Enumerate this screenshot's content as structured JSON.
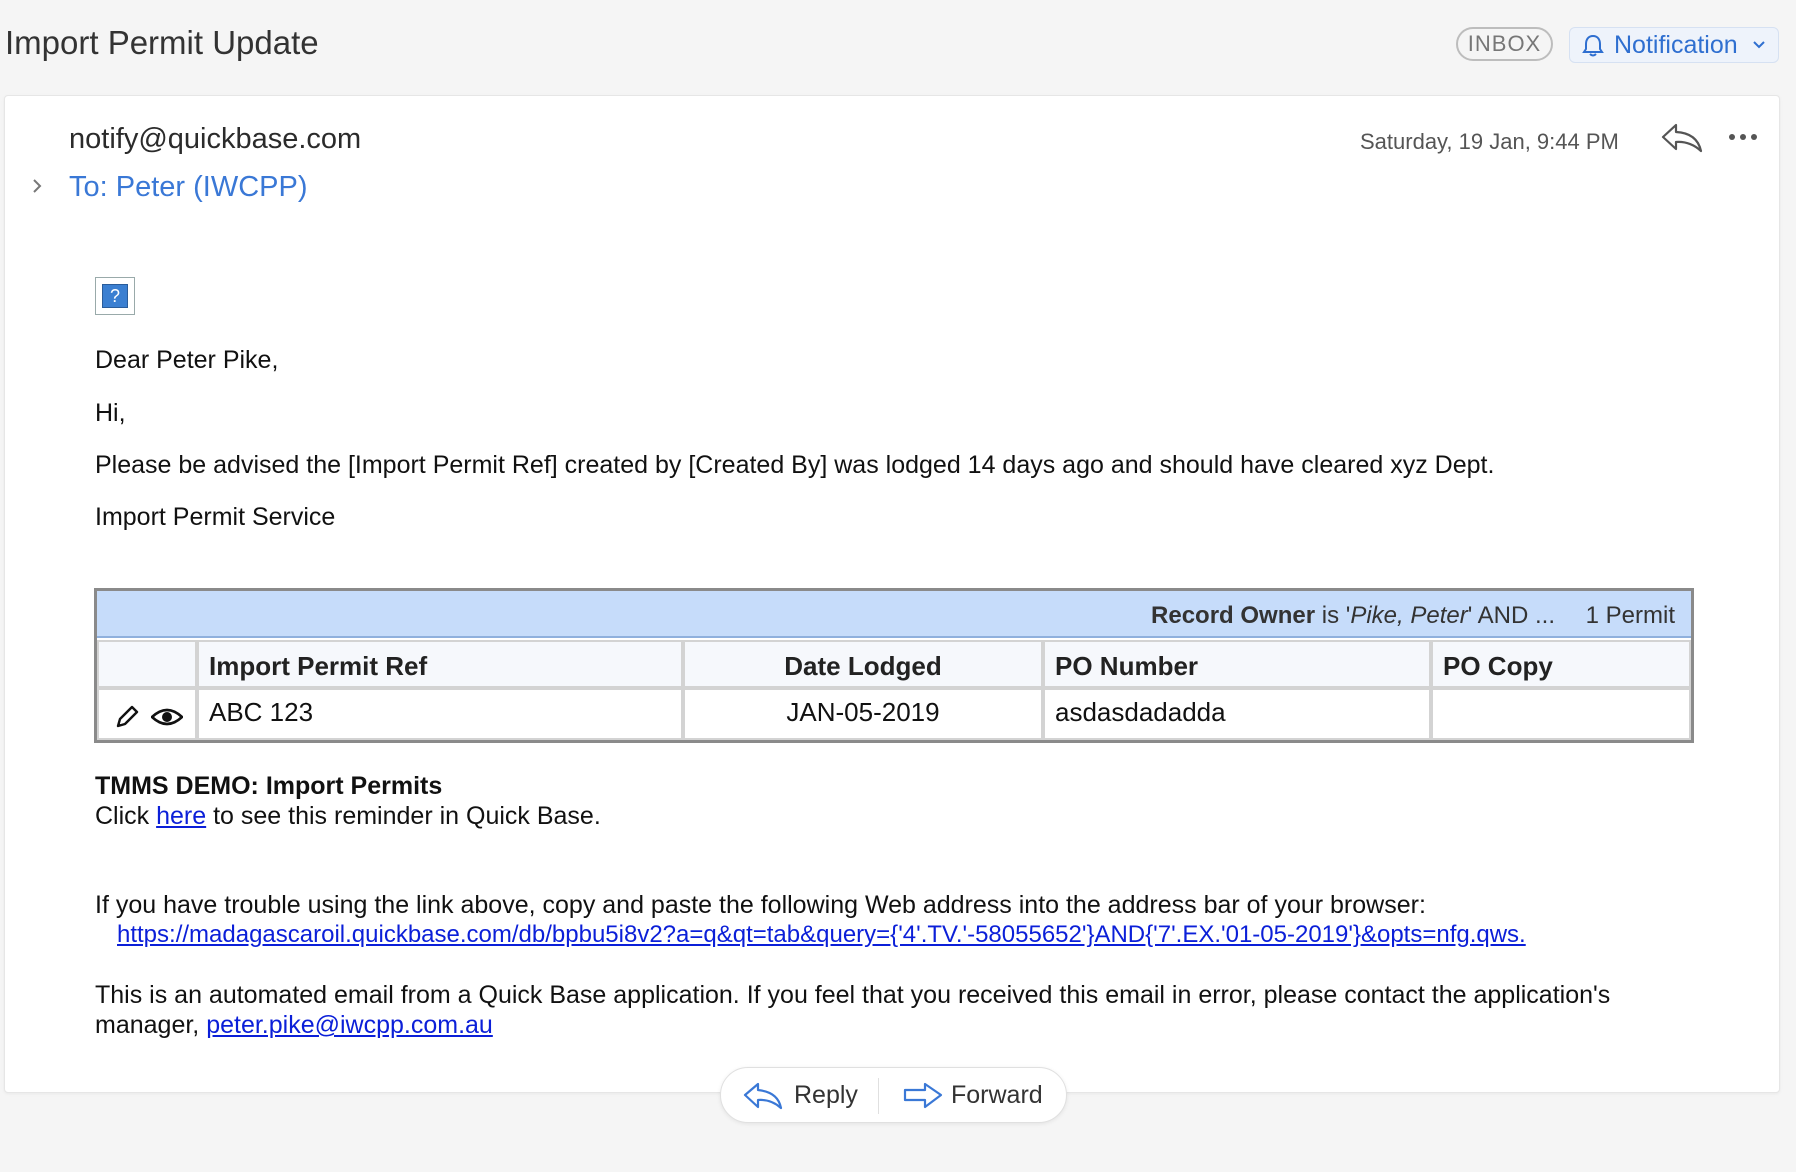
{
  "header": {
    "subject": "Import Permit Update",
    "folder_badge": "INBOX",
    "notification_label": "Notification"
  },
  "message": {
    "from": "notify@quickbase.com",
    "to": "To: Peter (IWCPP)",
    "timestamp": "Saturday, 19 Jan, 9:44 PM"
  },
  "body": {
    "broken_image_glyph": "?",
    "greeting": "Dear Peter Pike,",
    "hi": "Hi,",
    "advisory": "Please be advised the [Import Permit Ref] created by [Created By] was lodged 14 days ago and should have cleared xyz Dept.",
    "service": "Import Permit Service"
  },
  "table": {
    "filter_field": "Record Owner",
    "filter_is": " is '",
    "filter_value": "Pike, Peter",
    "filter_tail": "' AND ...",
    "count": "1 Permit",
    "columns": [
      "Import Permit Ref",
      "Date Lodged",
      "PO Number",
      "PO Copy"
    ],
    "rows": [
      {
        "import_permit_ref": "ABC 123",
        "date_lodged": "JAN-05-2019",
        "po_number": "asdasdadadda",
        "po_copy": ""
      }
    ]
  },
  "footer": {
    "app_name": "TMMS DEMO: Import Permits",
    "click_prefix": "Click ",
    "click_link": "here",
    "click_suffix": " to see this reminder in Quick Base.",
    "trouble_text": "If you have trouble using the link above, copy and paste the following Web address into the address bar of your browser:",
    "url": "https://madagascaroil.quickbase.com/db/bpbu5i8v2?a=q&qt=tab&query={'4'.TV.'-58055652'}AND{'7'.EX.'01-05-2019'}&opts=nfg.qws.",
    "automated_line1": "This is an automated email from a Quick Base application. If you feel that you received this email in error, please contact the application's",
    "automated_prefix": "manager, ",
    "manager_email": "peter.pike@iwcpp.com.au"
  },
  "actions": {
    "reply_label": "Reply",
    "forward_label": "Forward"
  },
  "colors": {
    "accent": "#3a78d6",
    "summary_bar": "#c6dcfa",
    "link": "#0b1fd8"
  },
  "icons": [
    "bell-icon",
    "chevron-down-icon",
    "chevron-right-icon",
    "reply-icon",
    "more-icon",
    "broken-image-icon",
    "pencil-icon",
    "eye-icon",
    "forward-icon"
  ]
}
